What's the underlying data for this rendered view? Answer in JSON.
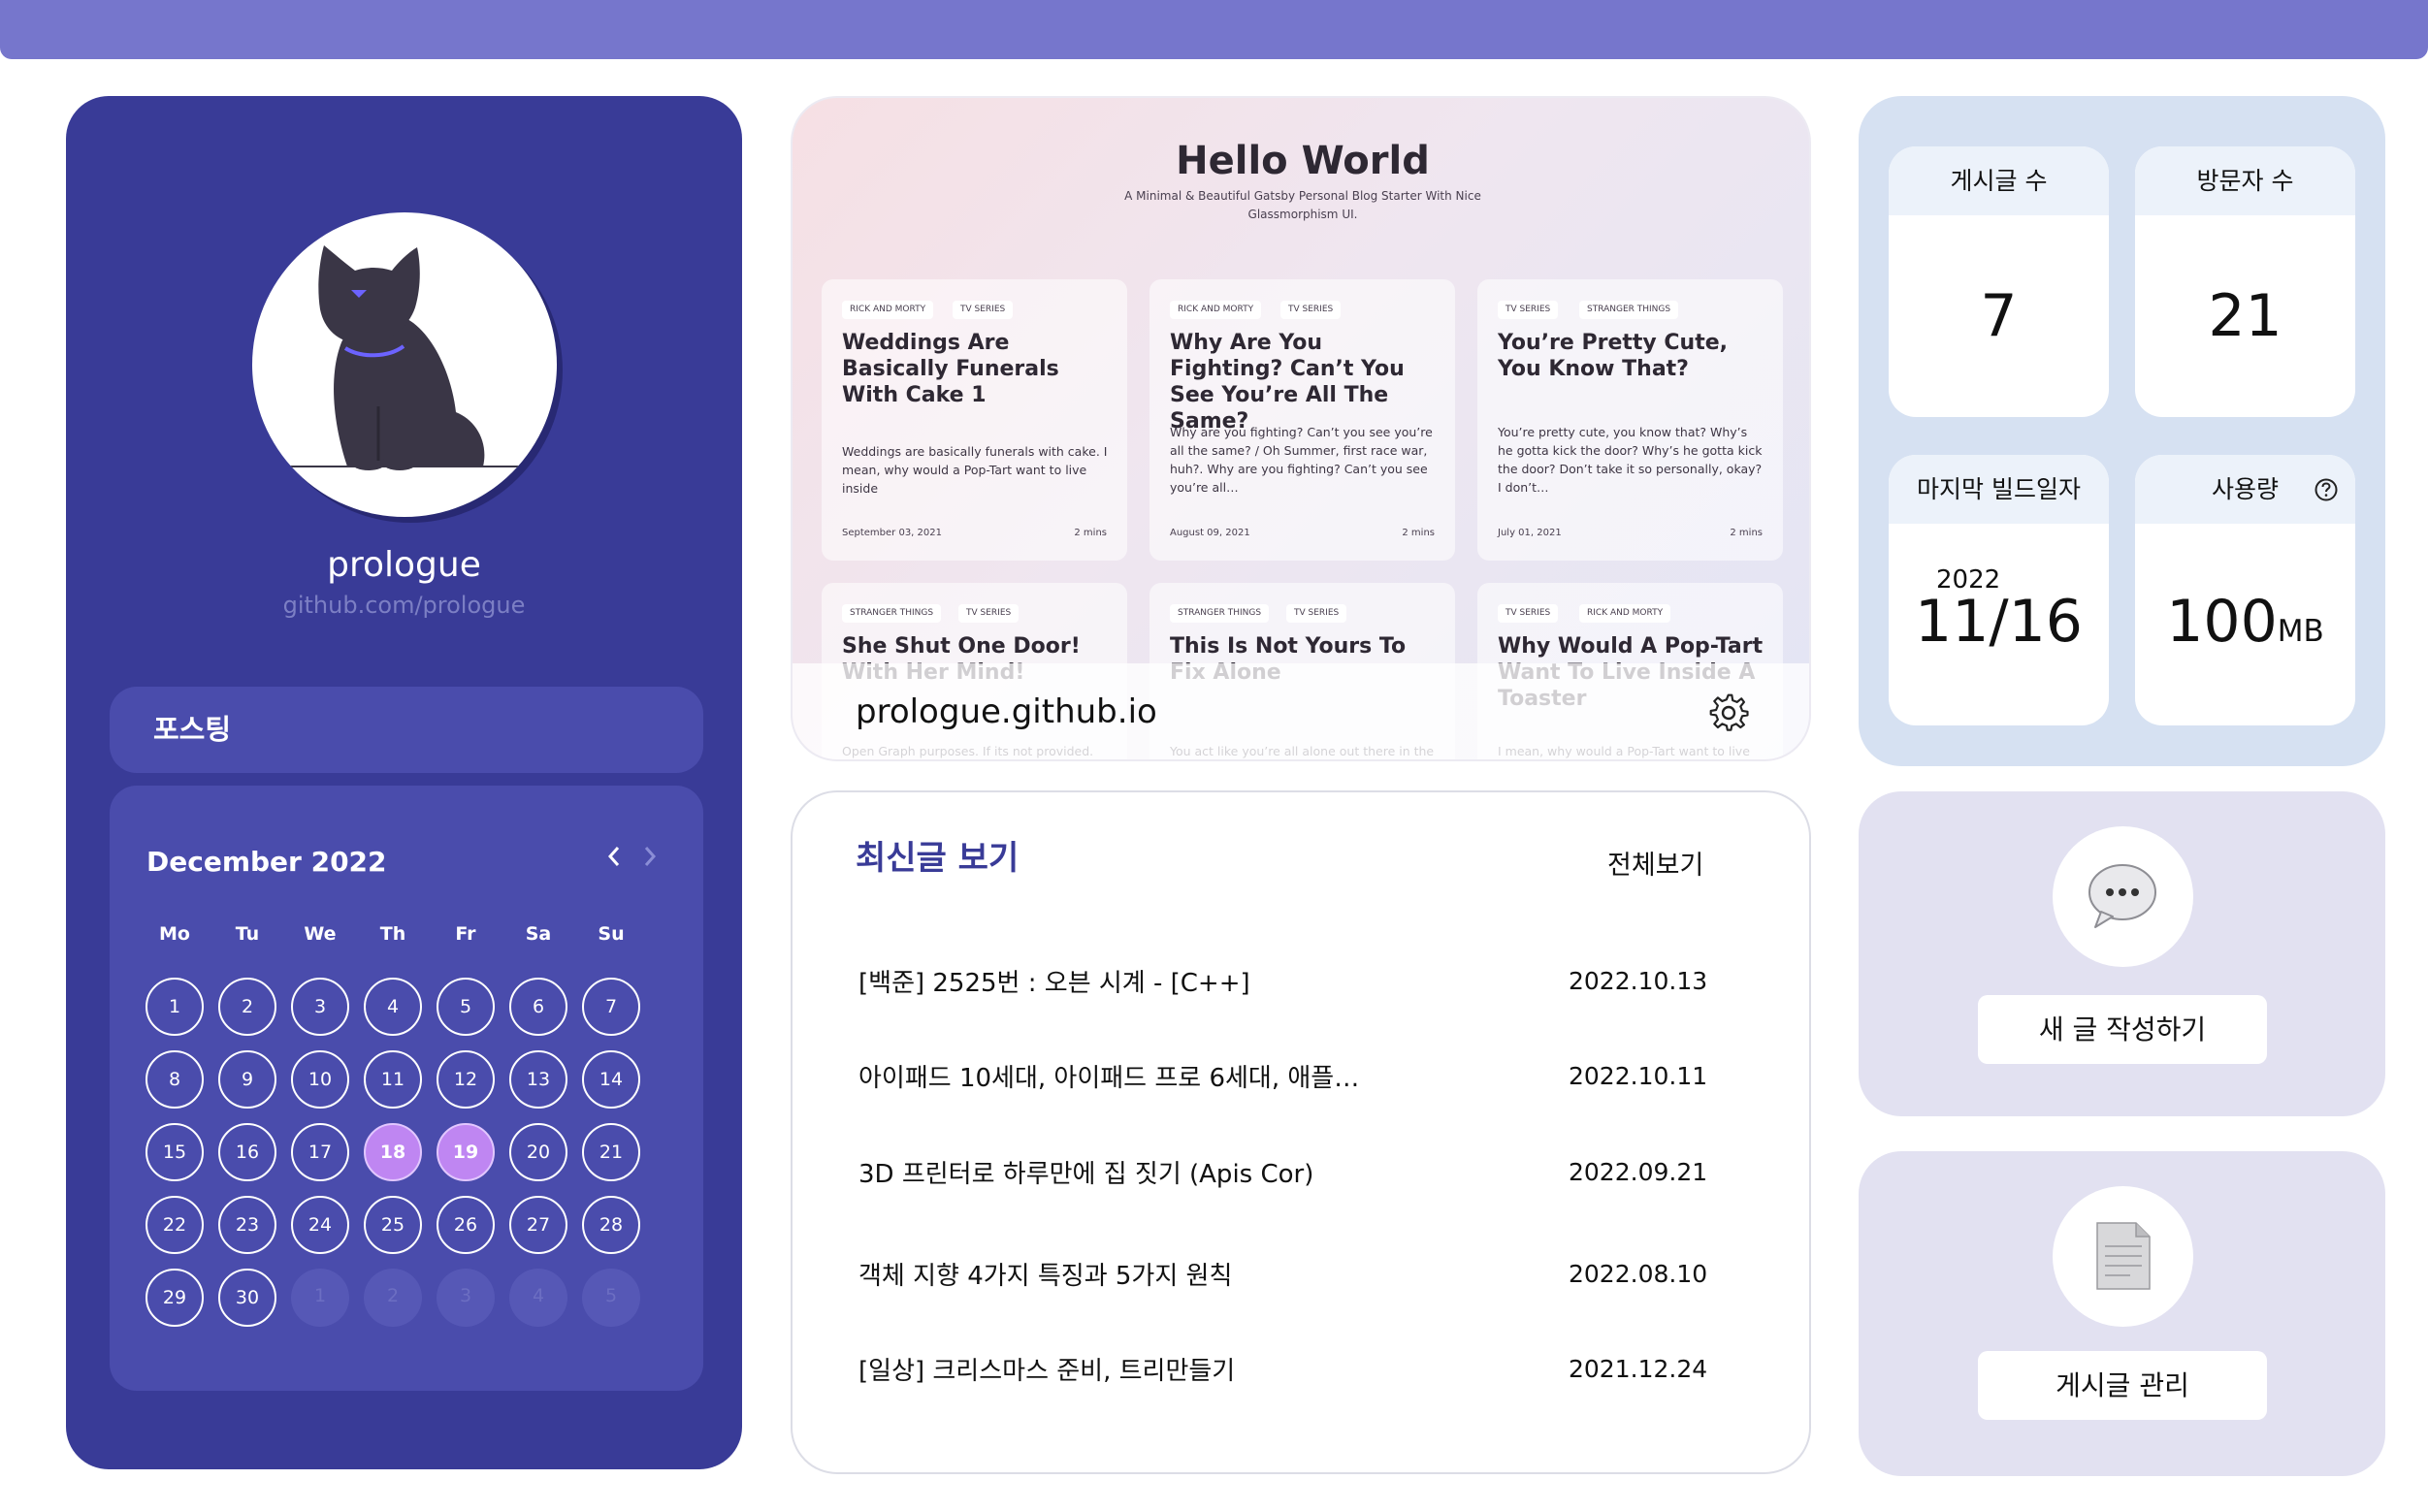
{
  "profile": {
    "name": "prologue",
    "link": "github.com/prologue",
    "posting_label": "포스팅"
  },
  "calendar": {
    "title": "December 2022",
    "prev_icon": "chevron-left-icon",
    "next_icon": "chevron-right-icon",
    "weekdays": [
      "Mo",
      "Tu",
      "We",
      "Th",
      "Fr",
      "Sa",
      "Su"
    ],
    "days": [
      "1",
      "2",
      "3",
      "4",
      "5",
      "6",
      "7",
      "8",
      "9",
      "10",
      "11",
      "12",
      "13",
      "14",
      "15",
      "16",
      "17",
      "18",
      "19",
      "20",
      "21",
      "22",
      "23",
      "24",
      "25",
      "26",
      "27",
      "28",
      "29",
      "30",
      "1",
      "2",
      "3",
      "4",
      "5"
    ],
    "selected": [
      "18",
      "19"
    ],
    "selected_color": "#bf86f2"
  },
  "preview": {
    "title": "Hello World",
    "subtitle": "A Minimal & Beautiful Gatsby Personal Blog Starter With Nice Glassmorphism UI.",
    "url": "prologue.github.io",
    "cards": [
      {
        "tags": [
          "RICK AND MORTY",
          "TV SERIES"
        ],
        "title": "Weddings Are Basically Funerals With Cake 1",
        "text": "Weddings are basically funerals with cake. I mean, why would a Pop-Tart want to live inside",
        "date": "September 03, 2021",
        "mins": "2 mins"
      },
      {
        "tags": [
          "RICK AND MORTY",
          "TV SERIES"
        ],
        "title": "Why Are You Fighting? Can’t You See You’re All The Same?",
        "text": "Why are you fighting? Can’t you see you’re all the same? / Oh Summer, first race war, huh?. Why are you fighting? Can’t you see you’re all…",
        "date": "August 09, 2021",
        "mins": "2 mins"
      },
      {
        "tags": [
          "TV SERIES",
          "STRANGER THINGS"
        ],
        "title": "You’re Pretty Cute, You Know That?",
        "text": "You’re pretty cute, you know that? Why’s he gotta kick the door? Why’s he gotta kick the door? Don’t take it so personally, okay? I don’t…",
        "date": "July 01, 2021",
        "mins": "2 mins"
      },
      {
        "tags": [
          "STRANGER THINGS",
          "TV SERIES"
        ],
        "title": "She Shut One Door! With Her Mind!",
        "text": "Open Graph purposes. If its not provided.",
        "date": "",
        "mins": ""
      },
      {
        "tags": [
          "STRANGER THINGS",
          "TV SERIES"
        ],
        "title": "This Is Not Yours To Fix Alone",
        "text": "You act like you’re all alone out there in the world, but you’re not. You’re not alone.",
        "date": "",
        "mins": ""
      },
      {
        "tags": [
          "TV SERIES",
          "RICK AND MORTY"
        ],
        "title": "Why Would A Pop-Tart Want To Live Inside A Toaster",
        "text": "I mean, why would a Pop-Tart want to live inside a toaster, Rick? I mean that",
        "date": "",
        "mins": ""
      }
    ]
  },
  "latest": {
    "title": "최신글 보기",
    "view_all": "전체보기",
    "posts": [
      {
        "title": "[백준] 2525번 : 오븐 시계 - [C++]",
        "date": "2022.10.13"
      },
      {
        "title": "아이패드 10세대, 아이패드 프로 6세대, 애플…",
        "date": "2022.10.11"
      },
      {
        "title": "3D 프린터로 하루만에 집 짓기 (Apis Cor)",
        "date": "2022.09.21"
      },
      {
        "title": "객체 지향 4가지 특징과 5가지 원칙",
        "date": "2022.08.10"
      },
      {
        "title": "[일상] 크리스마스 준비, 트리만들기",
        "date": "2021.12.24"
      }
    ]
  },
  "stats": {
    "posts_label": "게시글 수",
    "posts_value": "7",
    "visitors_label": "방문자 수",
    "visitors_value": "21",
    "build_label": "마지막 빌드일자",
    "build_year": "2022",
    "build_date": "11/16",
    "usage_label": "사용량",
    "usage_value": "100",
    "usage_unit": "MB",
    "usage_icon": "question-circle-icon"
  },
  "actions": {
    "write_label": "새 글 작성하기",
    "write_icon": "speech-bubble-icon",
    "manage_label": "게시글 관리",
    "manage_icon": "document-icon"
  },
  "colors": {
    "topbar": "#7676cc",
    "profile_panel": "#393b97",
    "accent_text": "#393b97",
    "stats_panel": "#d6e1f2",
    "action_panel": "#e2e1f1"
  }
}
